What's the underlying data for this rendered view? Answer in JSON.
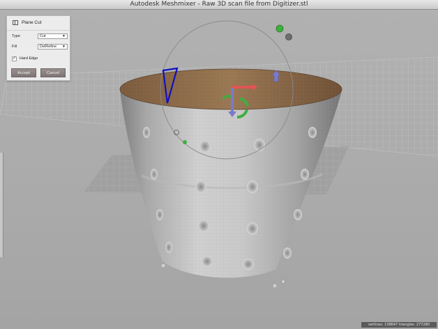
{
  "window": {
    "title": "Autodesk Meshmixer - Raw 3D scan file from Digitizer.stl"
  },
  "panel": {
    "title": "Plane Cut",
    "type_label": "Type",
    "type_value": "Cut",
    "fill_label": "Fill",
    "fill_value": "DelRefine",
    "hard_edge_label": "Hard Edge",
    "hard_edge_checked": true,
    "accept_label": "Accept",
    "cancel_label": "Cancel"
  },
  "status": {
    "text": "vertices: 138647 triangles: 277280"
  },
  "colors": {
    "cut_plane": "#8c6a48",
    "mesh": "#c8c8c8",
    "gizmo_red": "#e05555",
    "gizmo_green": "#3fae3f",
    "gizmo_blue": "#7a7ac6",
    "plane_outline": "#1010c0"
  },
  "icons": [
    "plane-cut-icon",
    "dropdown-arrow-icon",
    "checkmark-icon",
    "rotate-handle-icon"
  ]
}
